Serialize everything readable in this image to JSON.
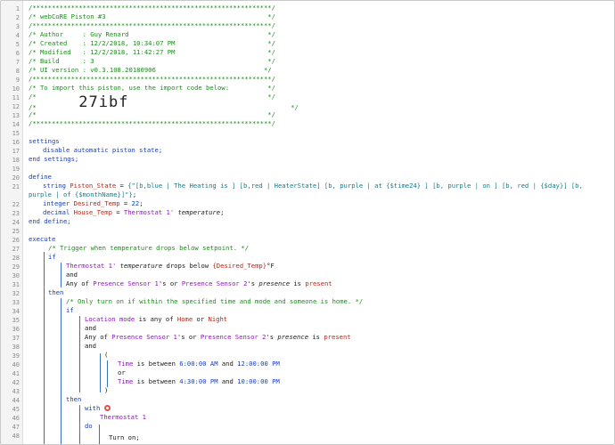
{
  "editor": {
    "line_numbers": [
      "1",
      "2",
      "3",
      "4",
      "5",
      "6",
      "7",
      "8",
      "9",
      "10",
      "11",
      "12",
      "13",
      "14",
      "15",
      "16",
      "17",
      "18",
      "19",
      "20",
      "21",
      "",
      "22",
      "23",
      "24",
      "25",
      "26",
      "27",
      "28",
      "29",
      "30",
      "31",
      "32",
      "33",
      "34",
      "35",
      "36",
      "37",
      "38",
      "39",
      "40",
      "41",
      "42",
      "43",
      "44",
      "45",
      "46",
      "47",
      "48"
    ],
    "header": {
      "border": "/**************************************************************/",
      "title": "/* webCoRE Piston #3                                          */",
      "author": "/* Author     : Guy Renard                                    */",
      "created": "/* Created    : 12/2/2018, 10:34:07 PM                        */",
      "modified": "/* Modified   : 12/2/2018, 11:42:27 PM                        */",
      "build": "/* Build      : 3                                             */",
      "ui_version": "/* UI version : v0.3.108.20180906                            */",
      "import_line": "/* To import this piston, use the import code below:          */",
      "blank": "/*                                                            */",
      "import_prefix": "/*           ",
      "import_code": "27ibf",
      "import_suffix": "                                          */"
    },
    "code": {
      "settings": "settings",
      "disable": "disable automatic piston state;",
      "end_settings": "end settings;",
      "define": "define",
      "l21_type": "string ",
      "l21_var": "Piston_State",
      "l21_eq": " = ",
      "l21_str1": "{\"[b,blue | The Heating is ] [b,red | HeaterState] [b, purple | at {$time24} ] [b, purple | on ] [b, red | {$day}] [b,",
      "l21_str2": "purple | of {$monthName}]\"}",
      "l21_end": ";",
      "l22_type": "integer ",
      "l22_var": "Desired_Temp",
      "l22_eq": " = ",
      "l22_val": "22",
      "l22_end": ";",
      "l23_type": "decimal ",
      "l23_var": "House_Temp",
      "l23_eq": " = ",
      "l23_dev": "Thermostat 1",
      "l23_q": "'",
      "l23_attr": "temperature",
      "l23_end": ";",
      "end_define": "end define;",
      "execute": "execute",
      "c27": "/* Trigger when temperature drops below setpoint. */",
      "if": "if",
      "l29_dev": "Thermostat 1",
      "l29_q": "' ",
      "l29_attr": "temperature",
      "l29_op": " drops below ",
      "l29_val": "{Desired_Temp}",
      "l29_unit": "°F",
      "and": "and",
      "any_of": "Any of ",
      "ps1": "Presence Sensor 1",
      "s_or": "'s or ",
      "ps2": "Presence Sensor 2",
      "s_q": "'s ",
      "presence": "presence",
      "is": " is ",
      "present": "present",
      "then": "then",
      "c33": "/* Only turn on if within the specified time and mode and someone is home. */",
      "location_mode": "Location mode",
      "is_any_of": " is any of ",
      "home": "Home",
      "or_word": " or ",
      "night": "Night",
      "paren_open": "(",
      "time": "Time",
      "is_between": " is between ",
      "t1a": "6:00:00 AM",
      "and_word": " and ",
      "t1b": "12:00:00 PM",
      "or": "or",
      "t2a": "4:30:00 PM",
      "t2b": "10:00:00 PM",
      "paren_close": ")",
      "with": "with",
      "thermostat": "Thermostat 1",
      "do": "do",
      "turn_on": "Turn on;"
    }
  }
}
